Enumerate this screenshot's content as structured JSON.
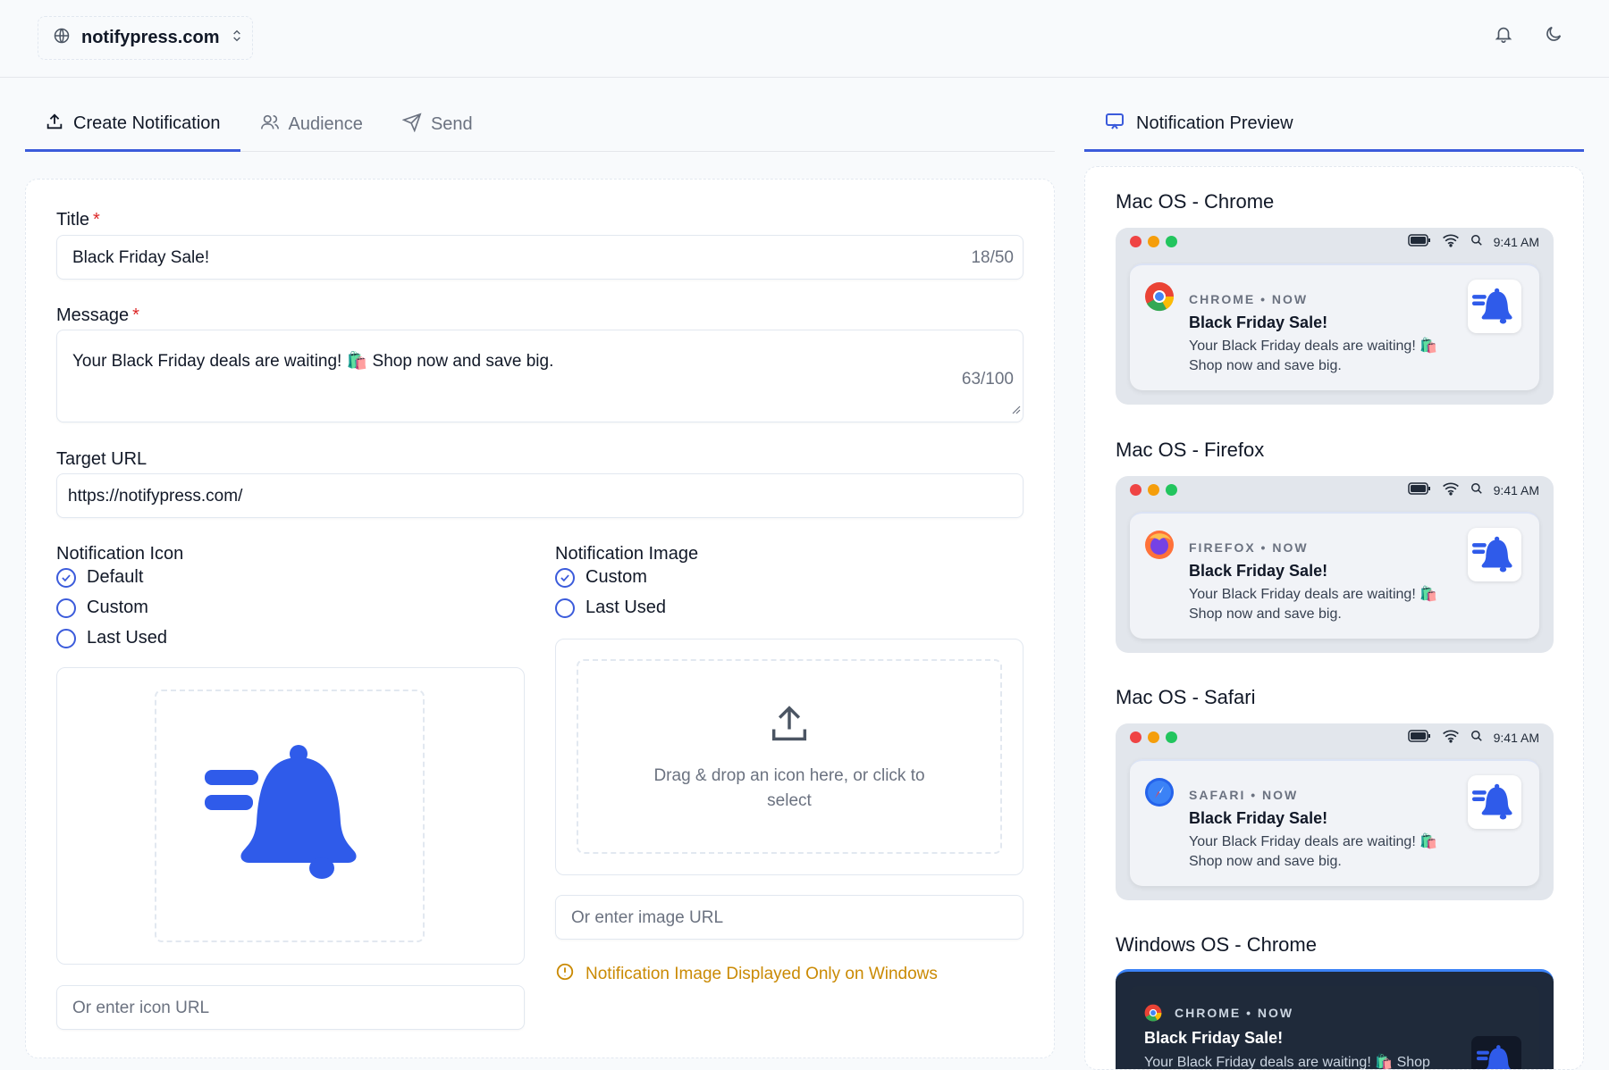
{
  "header": {
    "site_name": "notifypress.com",
    "icons": [
      "globe-icon",
      "chevron-updown-icon",
      "bell-icon",
      "moon-icon"
    ]
  },
  "tabs": [
    {
      "label": "Create Notification",
      "icon": "upload-icon",
      "active": true
    },
    {
      "label": "Audience",
      "icon": "users-icon",
      "active": false
    },
    {
      "label": "Send",
      "icon": "send-icon",
      "active": false
    }
  ],
  "preview_tab": {
    "label": "Notification Preview",
    "icon": "monitor-icon"
  },
  "form": {
    "title": {
      "label": "Title",
      "required_mark": "*",
      "value": "Black Friday Sale!",
      "counter": "18/50"
    },
    "message": {
      "label": "Message",
      "required_mark": "*",
      "value": "Your Black Friday deals are waiting! 🛍️ Shop now and save big.",
      "counter": "63/100"
    },
    "target_url": {
      "label": "Target URL",
      "value": "https://notifypress.com/"
    },
    "icon_section": {
      "label": "Notification Icon",
      "options": [
        "Default",
        "Custom",
        "Last Used"
      ],
      "selected": "Default",
      "url_placeholder": "Or enter icon URL"
    },
    "image_section": {
      "label": "Notification Image",
      "options": [
        "Custom",
        "Last Used"
      ],
      "selected": "Custom",
      "drop_text": "Drag & drop an icon here, or click to select",
      "url_placeholder": "Or enter image URL",
      "warning": "Notification Image Displayed Only on Windows"
    }
  },
  "preview": {
    "status_time": "9:41 AM",
    "title": "Black Friday Sale!",
    "message": "Your Black Friday deals are waiting! 🛍️ Shop now and save big.",
    "cards": [
      {
        "heading": "Mac OS - Chrome",
        "source": "CHROME • NOW"
      },
      {
        "heading": "Mac OS - Firefox",
        "source": "FIREFOX • NOW"
      },
      {
        "heading": "Mac OS - Safari",
        "source": "SAFARI • NOW"
      },
      {
        "heading": "Windows OS - Chrome",
        "source": "CHROME • NOW",
        "message": "Your Black Friday deals are waiting! 🛍️ Shop"
      }
    ]
  },
  "colors": {
    "accent": "#3b5bdb",
    "bell_blue": "#2f5bea",
    "required": "#dc2626",
    "warning": "#ca8a04",
    "mac_red": "#ef4444",
    "mac_yellow": "#f59e0b",
    "mac_green": "#22c55e"
  }
}
